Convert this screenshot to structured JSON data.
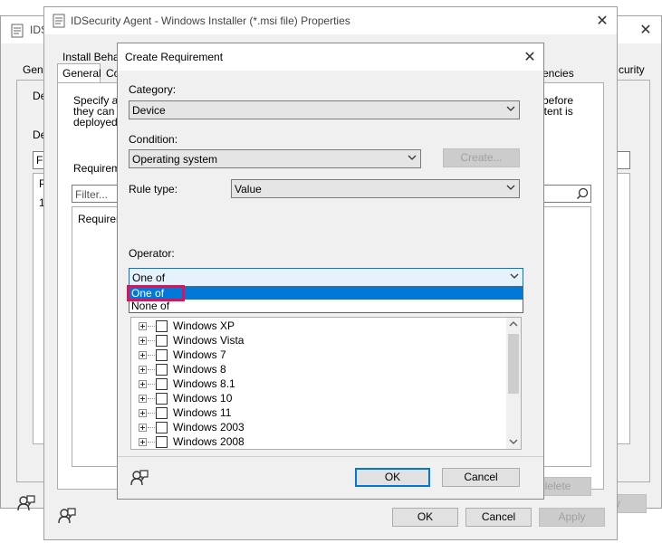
{
  "back_window": {
    "title": "IDS",
    "tabs": [
      "Gene",
      "curity"
    ],
    "labels": [
      "De",
      "De"
    ],
    "filter_fragment": "Fil",
    "rows": [
      "P",
      "1"
    ]
  },
  "props_window": {
    "title": "IDSecurity Agent - Windows Installer (*.msi file) Properties",
    "tabs_row1": [
      "Install Behav"
    ],
    "tabs_row2": [
      "General",
      "Co",
      "encies"
    ],
    "description_left": [
      "Specify an",
      "they can in",
      "deployed t"
    ],
    "description_right": [
      "before",
      "ntent is"
    ],
    "requirements_label": "Requireme",
    "filter_placeholder": "Filter...",
    "column_header": "Requirem",
    "delete_label": "lelete",
    "buttons": {
      "ok": "OK",
      "cancel": "Cancel",
      "apply": "Apply",
      "apply_back": "ply"
    }
  },
  "dialog": {
    "title": "Create Requirement",
    "category_label": "Category:",
    "category_value": "Device",
    "condition_label": "Condition:",
    "condition_value": "Operating system",
    "create_button": "Create...",
    "rule_type_label": "Rule type:",
    "rule_type_value": "Value",
    "operator_label": "Operator:",
    "operator_value": "One of",
    "operator_options": [
      "One of",
      "None of"
    ],
    "os_items": [
      "Windows XP",
      "Windows Vista",
      "Windows 7",
      "Windows 8",
      "Windows 8.1",
      "Windows 10",
      "Windows 11",
      "Windows 2003",
      "Windows 2008"
    ],
    "ok_button": "OK",
    "cancel_button": "Cancel"
  },
  "colors": {
    "accent": "#0078d7",
    "highlight_border": "#e0105a",
    "warning": "#e8730c"
  },
  "icons": [
    "window-icon",
    "properties-icon",
    "chevron-down-icon",
    "search-icon",
    "user-help-icon",
    "warning-icon",
    "close-icon"
  ]
}
